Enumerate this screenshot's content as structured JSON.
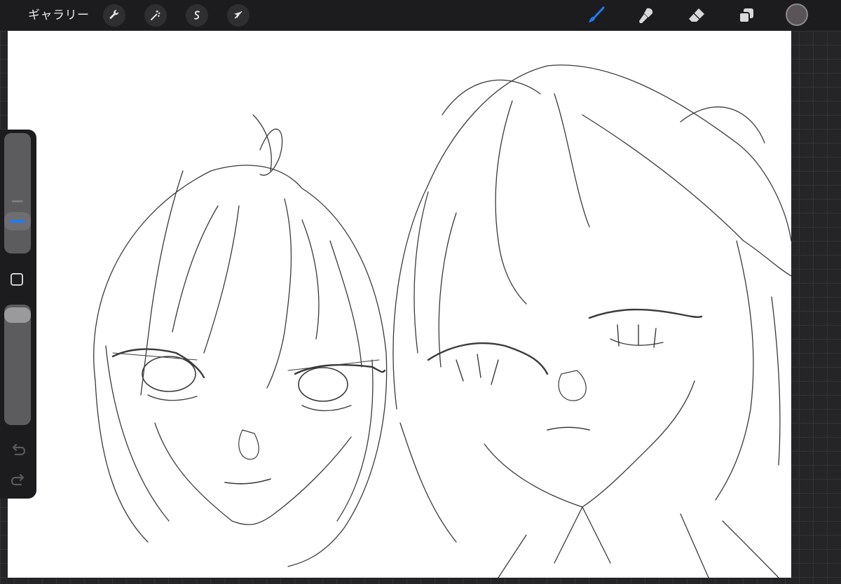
{
  "topbar": {
    "gallery_label": "ギャラリー",
    "left_tools": [
      {
        "name": "actions",
        "icon": "wrench-icon"
      },
      {
        "name": "adjustments",
        "icon": "magic-wand-icon"
      },
      {
        "name": "selection",
        "icon": "selection-s-icon"
      },
      {
        "name": "transform",
        "icon": "arrow-cursor-icon"
      }
    ],
    "right_tools": [
      {
        "name": "brush",
        "icon": "brush-icon",
        "active": true
      },
      {
        "name": "smudge",
        "icon": "smudge-icon",
        "active": false
      },
      {
        "name": "eraser",
        "icon": "eraser-icon",
        "active": false
      },
      {
        "name": "layers",
        "icon": "layers-icon",
        "active": false
      }
    ],
    "current_color": "#5a5458"
  },
  "sidebar": {
    "brush_size_level": 0.3,
    "brush_opacity_level": 1.0,
    "accent_color": "#1e7cf2"
  },
  "colors": {
    "active_tool": "#1e7cf2",
    "inactive_tool": "#d9d9d9"
  }
}
